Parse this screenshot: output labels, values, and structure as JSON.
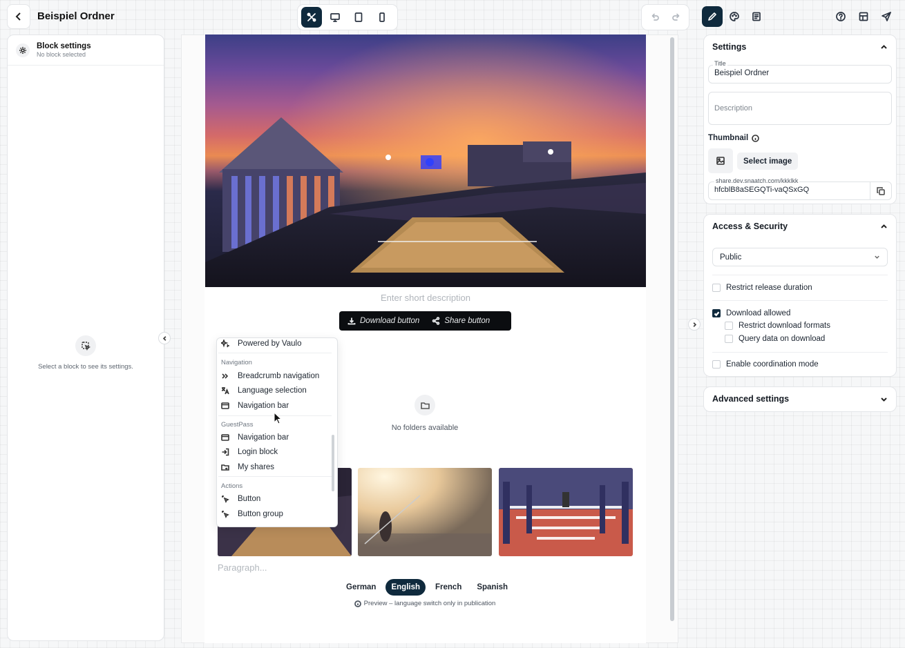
{
  "header": {
    "title": "Beispiel Ordner"
  },
  "left_panel": {
    "block_title": "Block settings",
    "block_subtitle": "No block selected",
    "empty_text": "Select a block to see its settings."
  },
  "canvas": {
    "short_description_placeholder": "Enter short description",
    "download_button": "Download button",
    "share_button": "Share button",
    "no_folders": "No folders available",
    "paragraph_placeholder": "Paragraph...",
    "languages": [
      "German",
      "English",
      "French",
      "Spanish"
    ],
    "active_language": "English",
    "preview_note": "Preview – language switch only in publication"
  },
  "block_menu": {
    "top_item": "Powered by Vaulo",
    "sections": [
      {
        "heading": "Navigation",
        "items": [
          "Breadcrumb navigation",
          "Language selection",
          "Navigation bar"
        ]
      },
      {
        "heading": "GuestPass",
        "items": [
          "Navigation bar",
          "Login block",
          "My shares"
        ]
      },
      {
        "heading": "Actions",
        "items": [
          "Button",
          "Button group"
        ]
      }
    ]
  },
  "settings": {
    "heading": "Settings",
    "title_label": "Title",
    "title_value": "Beispiel Ordner",
    "description_placeholder": "Description",
    "thumbnail_label": "Thumbnail",
    "select_image": "Select image",
    "share_label": "share.dev.snaatch.com/kkklkk",
    "share_value": "hfcblB8aSEGQTi-vaQSxGQ"
  },
  "access": {
    "heading": "Access & Security",
    "visibility": "Public",
    "restrict_release": {
      "label": "Restrict release duration",
      "checked": false
    },
    "download_allowed": {
      "label": "Download allowed",
      "checked": true
    },
    "restrict_formats": {
      "label": "Restrict download formats",
      "checked": false
    },
    "query_data": {
      "label": "Query data on download",
      "checked": false
    },
    "coordination": {
      "label": "Enable coordination mode",
      "checked": false
    }
  },
  "advanced": {
    "heading": "Advanced settings"
  },
  "colors": {
    "accent": "#0f2a3d",
    "canvas_bg": "#ffffff"
  }
}
